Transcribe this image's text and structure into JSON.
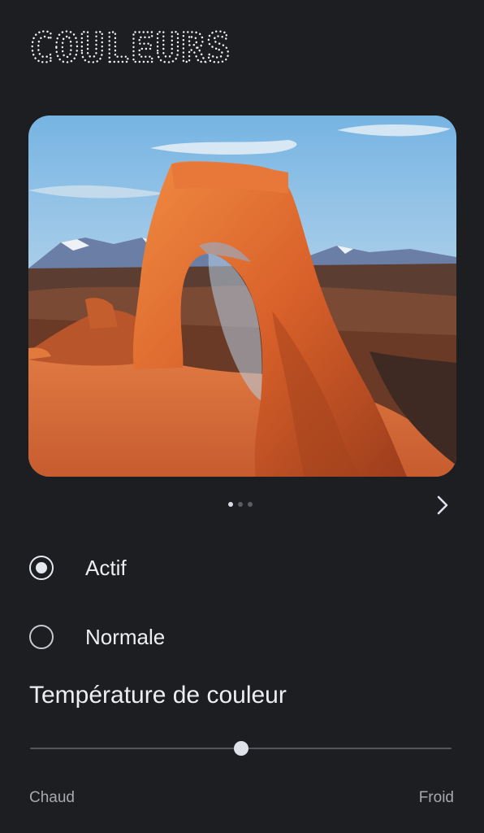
{
  "header": {
    "title": "COULEURS"
  },
  "preview": {
    "image_description": "desert stone arch landscape",
    "pager": {
      "count": 3,
      "active_index": 0
    },
    "next_icon": "chevron-right-icon"
  },
  "mode_options": [
    {
      "label": "Actif",
      "selected": true
    },
    {
      "label": "Normale",
      "selected": false
    }
  ],
  "temperature": {
    "heading": "Température de couleur",
    "value_fraction": 0.5,
    "min_label": "Chaud",
    "max_label": "Froid"
  },
  "colors": {
    "background": "#1d1e22",
    "accent": "#e6e8f0",
    "track": "#55575d",
    "secondary_text": "#a7a9af"
  }
}
